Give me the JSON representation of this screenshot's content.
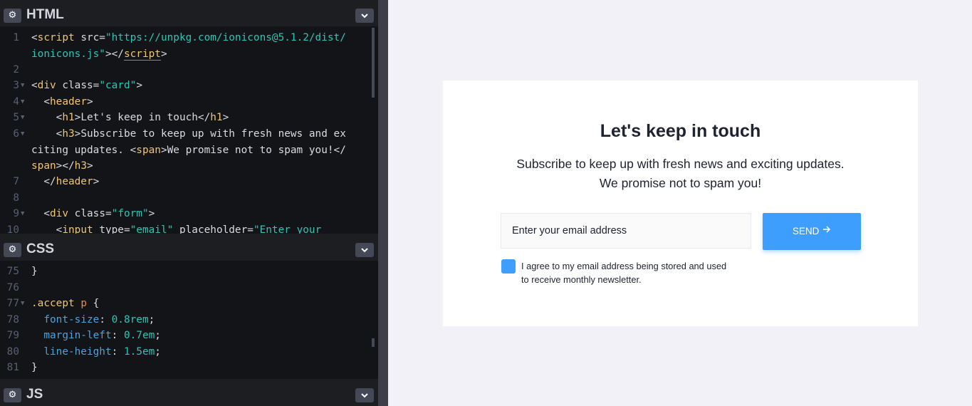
{
  "panes": {
    "html": {
      "title": "HTML"
    },
    "css": {
      "title": "CSS"
    },
    "js": {
      "title": "JS"
    }
  },
  "icons": {
    "pane_settings": "gear-icon",
    "pane_collapse": "chevron-down-icon",
    "send_arrow": "arrow-forward-icon"
  },
  "html_code": [
    {
      "n": "1",
      "fold": false,
      "parts": [
        [
          "",
          "<"
        ],
        [
          "tag",
          "script"
        ],
        [
          "",
          " src="
        ],
        [
          "str",
          "\"https://unpkg.com/ionicons@5.1.2/dist/ionicons.js\""
        ],
        [
          "",
          "></"
        ],
        [
          "tagu",
          "script"
        ],
        [
          "",
          ">"
        ]
      ]
    },
    {
      "n": "2",
      "fold": false,
      "parts": []
    },
    {
      "n": "3",
      "fold": true,
      "parts": [
        [
          "",
          "<"
        ],
        [
          "tag",
          "div"
        ],
        [
          "",
          " class="
        ],
        [
          "str",
          "\"card\""
        ],
        [
          "",
          ">"
        ]
      ]
    },
    {
      "n": "4",
      "fold": true,
      "parts": [
        [
          "",
          "  <"
        ],
        [
          "tag",
          "header"
        ],
        [
          "",
          ">"
        ]
      ]
    },
    {
      "n": "5",
      "fold": true,
      "parts": [
        [
          "",
          "    <"
        ],
        [
          "tag",
          "h1"
        ],
        [
          "",
          ">Let's keep in touch</"
        ],
        [
          "tag",
          "h1"
        ],
        [
          "",
          ">"
        ]
      ]
    },
    {
      "n": "6",
      "fold": true,
      "parts": [
        [
          "",
          "    <"
        ],
        [
          "tag",
          "h3"
        ],
        [
          "",
          ">Subscribe to keep up with fresh news and exciting updates. <"
        ],
        [
          "tag",
          "span"
        ],
        [
          "",
          ">We promise not to spam you!</"
        ],
        [
          "tag",
          "span"
        ],
        [
          "",
          "></"
        ],
        [
          "tag",
          "h3"
        ],
        [
          "",
          ">"
        ]
      ]
    },
    {
      "n": "7",
      "fold": false,
      "parts": [
        [
          "",
          "  </"
        ],
        [
          "tag",
          "header"
        ],
        [
          "",
          ">"
        ]
      ]
    },
    {
      "n": "8",
      "fold": false,
      "parts": []
    },
    {
      "n": "9",
      "fold": true,
      "parts": [
        [
          "",
          "  <"
        ],
        [
          "tag",
          "div"
        ],
        [
          "",
          " class="
        ],
        [
          "str",
          "\"form\""
        ],
        [
          "",
          ">"
        ]
      ]
    },
    {
      "n": "10",
      "fold": false,
      "parts": [
        [
          "",
          "    <"
        ],
        [
          "tag",
          "input"
        ],
        [
          "",
          " type="
        ],
        [
          "str",
          "\"email\""
        ],
        [
          "",
          " placeholder="
        ],
        [
          "str",
          "\"Enter your"
        ]
      ]
    }
  ],
  "css_code": [
    {
      "n": "75",
      "fold": false,
      "parts": [
        [
          "",
          "}"
        ]
      ]
    },
    {
      "n": "76",
      "fold": false,
      "parts": []
    },
    {
      "n": "77",
      "fold": true,
      "parts": [
        [
          "sel",
          ".accept"
        ],
        [
          "",
          " "
        ],
        [
          "el",
          "p"
        ],
        [
          "",
          " {"
        ]
      ]
    },
    {
      "n": "78",
      "fold": false,
      "parts": [
        [
          "",
          "  "
        ],
        [
          "kw",
          "font-size"
        ],
        [
          "",
          ": "
        ],
        [
          "num",
          "0.8rem"
        ],
        [
          "",
          ";"
        ]
      ]
    },
    {
      "n": "79",
      "fold": false,
      "parts": [
        [
          "",
          "  "
        ],
        [
          "kw",
          "margin-left"
        ],
        [
          "",
          ": "
        ],
        [
          "num",
          "0.7em"
        ],
        [
          "",
          ";"
        ]
      ]
    },
    {
      "n": "80",
      "fold": false,
      "parts": [
        [
          "",
          "  "
        ],
        [
          "kw",
          "line-height"
        ],
        [
          "",
          ": "
        ],
        [
          "num",
          "1.5em"
        ],
        [
          "",
          ";"
        ]
      ]
    },
    {
      "n": "81",
      "fold": false,
      "parts": [
        [
          "",
          "}"
        ]
      ]
    }
  ],
  "preview": {
    "heading": "Let's keep in touch",
    "subheading": "Subscribe to keep up with fresh news and exciting updates.",
    "subheading_span": "We promise not to spam you!",
    "email_placeholder": "Enter your email address",
    "send_label": "SEND",
    "agree_text": "I agree to my email address being stored and used to receive monthly newsletter.",
    "accent_color": "#3d9efe"
  }
}
